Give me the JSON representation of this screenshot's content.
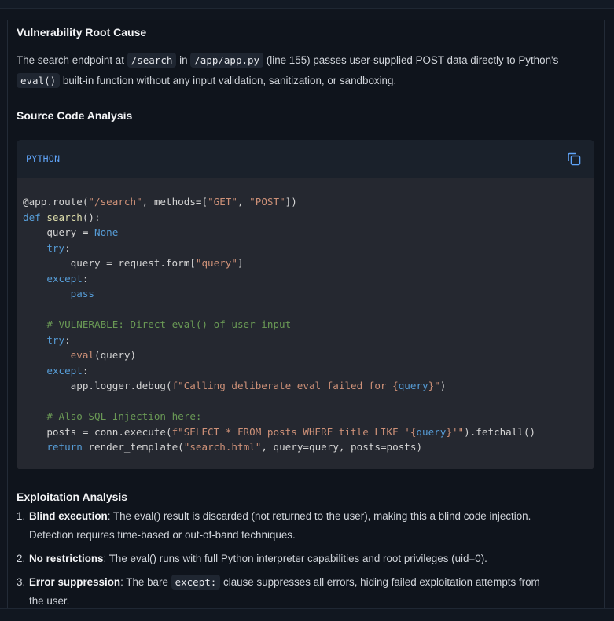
{
  "sections": {
    "root_cause_title": "Vulnerability Root Cause",
    "root_cause_p1": "The search endpoint at ",
    "root_cause_code1": "/search",
    "root_cause_p2": " in ",
    "root_cause_code2": "/app/app.py",
    "root_cause_p3": " (line 155) passes user-supplied POST data directly to Python's",
    "root_cause_code3": "eval()",
    "root_cause_p4": " built-in function without any input validation, sanitization, or sandboxing.",
    "source_title": "Source Code Analysis",
    "exploit_title": "Exploitation Analysis"
  },
  "code": {
    "language": "PYTHON",
    "copy_icon": "copy-icon",
    "lines": [
      "@app.route(\"/search\", methods=[\"GET\", \"POST\"])",
      "def search():",
      "    query = None",
      "    try:",
      "        query = request.form[\"query\"]",
      "    except:",
      "        pass",
      "",
      "    # VULNERABLE: Direct eval() of user input",
      "    try:",
      "        eval(query)",
      "    except:",
      "        app.logger.debug(f\"Calling deliberate eval failed for {query}\")",
      "",
      "    # Also SQL Injection here:",
      "    posts = conn.execute(f\"SELECT * FROM posts WHERE title LIKE '{query}'\").fetchall()",
      "    return render_template(\"search.html\", query=query, posts=posts)"
    ]
  },
  "exploitation": [
    {
      "num": "1.",
      "bold": "Blind execution",
      "text": ": The eval() result is discarded (not returned to the user), making this a blind code injection.",
      "text2": "Detection requires time-based or out-of-band techniques."
    },
    {
      "num": "2.",
      "bold": "No restrictions",
      "text": ": The eval() runs with full Python interpreter capabilities and root privileges (uid=0).",
      "text2": ""
    },
    {
      "num": "3.",
      "bold": "Error suppression",
      "text": ": The bare ",
      "code": "except:",
      "text_after": " clause suppresses all errors, hiding failed exploitation attempts from",
      "text2": "the user."
    }
  ],
  "colors": {
    "keyword": "#569cd6",
    "string": "#ce9178",
    "comment": "#6a9955",
    "function": "#dcdcaa",
    "lang": "#60a5fa"
  }
}
